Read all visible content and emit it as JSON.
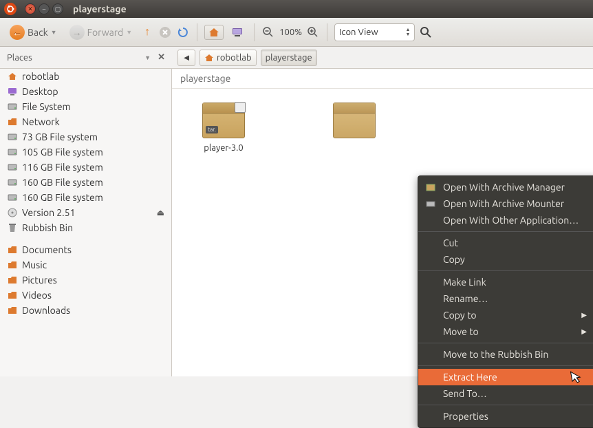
{
  "window": {
    "title": "playerstage"
  },
  "toolbar": {
    "back": "Back",
    "forward": "Forward",
    "zoom": "100%",
    "view_mode": "Icon View"
  },
  "places_header": "Places",
  "breadcrumb": {
    "segments": [
      "robotlab",
      "playerstage"
    ]
  },
  "location_label": "playerstage",
  "sidebar": {
    "items": [
      {
        "label": "robotlab",
        "icon": "home",
        "color": "#dd7a2f"
      },
      {
        "label": "Desktop",
        "icon": "desktop",
        "color": "#9b6bd1"
      },
      {
        "label": "File System",
        "icon": "disk",
        "color": "#888"
      },
      {
        "label": "Network",
        "icon": "folder",
        "color": "#dd7a2f"
      },
      {
        "label": "73 GB File system",
        "icon": "disk",
        "color": "#888"
      },
      {
        "label": "105 GB File system",
        "icon": "disk",
        "color": "#888"
      },
      {
        "label": "116 GB File system",
        "icon": "disk",
        "color": "#888"
      },
      {
        "label": "160 GB File system",
        "icon": "disk",
        "color": "#888"
      },
      {
        "label": "160 GB File system",
        "icon": "disk",
        "color": "#888"
      },
      {
        "label": "Version 2.51",
        "icon": "cd",
        "color": "#999",
        "eject": true
      },
      {
        "label": "Rubbish Bin",
        "icon": "trash",
        "color": "#777"
      }
    ],
    "items2": [
      {
        "label": "Documents",
        "icon": "folder",
        "color": "#dd7a2f"
      },
      {
        "label": "Music",
        "icon": "folder",
        "color": "#dd7a2f"
      },
      {
        "label": "Pictures",
        "icon": "folder",
        "color": "#dd7a2f"
      },
      {
        "label": "Videos",
        "icon": "folder",
        "color": "#dd7a2f"
      },
      {
        "label": "Downloads",
        "icon": "folder",
        "color": "#dd7a2f"
      }
    ]
  },
  "files": [
    {
      "name": "player-3.0",
      "tag": "tar."
    },
    {
      "name": "",
      "tag": ""
    }
  ],
  "context_menu": {
    "items": [
      {
        "label": "Open With Archive Manager",
        "icon": "pkg"
      },
      {
        "label": "Open With Archive Mounter",
        "icon": "mount"
      },
      {
        "label": "Open With Other Application…"
      },
      {
        "sep": true
      },
      {
        "label": "Cut"
      },
      {
        "label": "Copy"
      },
      {
        "sep": true
      },
      {
        "label": "Make Link"
      },
      {
        "label": "Rename…"
      },
      {
        "label": "Copy to",
        "submenu": true
      },
      {
        "label": "Move to",
        "submenu": true
      },
      {
        "sep": true
      },
      {
        "label": "Move to the Rubbish Bin"
      },
      {
        "sep": true
      },
      {
        "label": "Extract Here",
        "hover": true
      },
      {
        "label": "Send To…"
      },
      {
        "sep": true
      },
      {
        "label": "Properties"
      }
    ]
  }
}
